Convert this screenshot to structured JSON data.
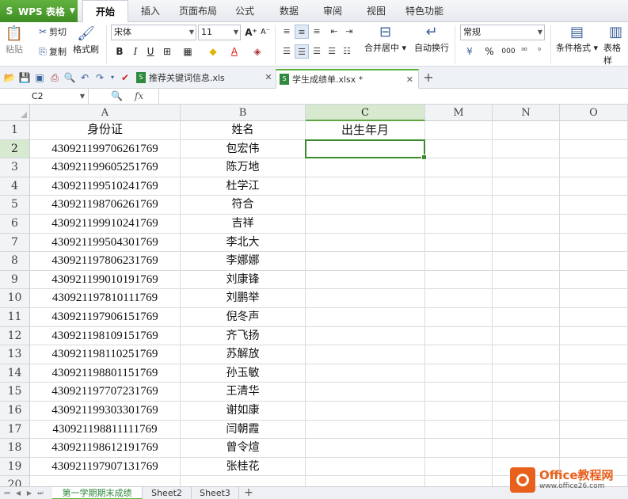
{
  "app": {
    "name": "WPS 表格",
    "logo_glyph": "S"
  },
  "menu": {
    "tabs": [
      {
        "label": "开始",
        "active": true
      },
      {
        "label": "插入"
      },
      {
        "label": "页面布局"
      },
      {
        "label": "公式"
      },
      {
        "label": "数据"
      },
      {
        "label": "审阅"
      },
      {
        "label": "视图"
      },
      {
        "label": "特色功能"
      }
    ]
  },
  "ribbon": {
    "paste": "粘贴",
    "cut": "剪切",
    "copy": "复制",
    "format_painter": "格式刷",
    "font_name": "宋体",
    "font_size": "11",
    "merge_center": "合并居中",
    "wrap_text": "自动换行",
    "number_format": "常规",
    "percent": "%",
    "thousands": "000",
    "conditional_format": "条件格式",
    "table_style": "表格样"
  },
  "doc_tabs": [
    {
      "label": "推荐关键词信息.xls",
      "active": false
    },
    {
      "label": "学生成绩单.xlsx *",
      "active": true
    }
  ],
  "formula_bar": {
    "name_box": "C2",
    "fx": "fx",
    "value": ""
  },
  "grid": {
    "columns": [
      "A",
      "B",
      "C",
      "M",
      "N",
      "O"
    ],
    "rows": [
      {
        "n": "1",
        "id": "身份证",
        "name": "姓名",
        "c": "出生年月"
      },
      {
        "n": "2",
        "id": "430921199706261769",
        "name": "包宏伟",
        "c": ""
      },
      {
        "n": "3",
        "id": "430921199605251769",
        "name": "陈万地",
        "c": ""
      },
      {
        "n": "4",
        "id": "430921199510241769",
        "name": "杜学江",
        "c": ""
      },
      {
        "n": "5",
        "id": "430921198706261769",
        "name": "符合",
        "c": ""
      },
      {
        "n": "6",
        "id": "430921199910241769",
        "name": "吉祥",
        "c": ""
      },
      {
        "n": "7",
        "id": "430921199504301769",
        "name": "李北大",
        "c": ""
      },
      {
        "n": "8",
        "id": "430921197806231769",
        "name": "李娜娜",
        "c": ""
      },
      {
        "n": "9",
        "id": "430921199010191769",
        "name": "刘康锋",
        "c": ""
      },
      {
        "n": "10",
        "id": "430921197810111769",
        "name": "刘鹏举",
        "c": ""
      },
      {
        "n": "11",
        "id": "430921197906151769",
        "name": "倪冬声",
        "c": ""
      },
      {
        "n": "12",
        "id": "430921198109151769",
        "name": "齐飞扬",
        "c": ""
      },
      {
        "n": "13",
        "id": "430921198110251769",
        "name": "苏解放",
        "c": ""
      },
      {
        "n": "14",
        "id": "430921198801151769",
        "name": "孙玉敏",
        "c": ""
      },
      {
        "n": "15",
        "id": "430921197707231769",
        "name": "王清华",
        "c": ""
      },
      {
        "n": "16",
        "id": "430921199303301769",
        "name": "谢如康",
        "c": ""
      },
      {
        "n": "17",
        "id": "430921198811111769",
        "name": "闫朝霞",
        "c": ""
      },
      {
        "n": "18",
        "id": "430921198612191769",
        "name": "曾令煊",
        "c": ""
      },
      {
        "n": "19",
        "id": "430921197907131769",
        "name": "张桂花",
        "c": ""
      },
      {
        "n": "20",
        "id": "",
        "name": "",
        "c": ""
      }
    ]
  },
  "sheets": [
    {
      "label": "第一学期期末成绩",
      "active": true
    },
    {
      "label": "Sheet2"
    },
    {
      "label": "Sheet3"
    }
  ],
  "watermark": {
    "title": "Office教程网",
    "url": "www.office26.com"
  },
  "colors": {
    "accent": "#61b33f",
    "selection": "#3c8a2e",
    "brand": "#e8601c"
  }
}
